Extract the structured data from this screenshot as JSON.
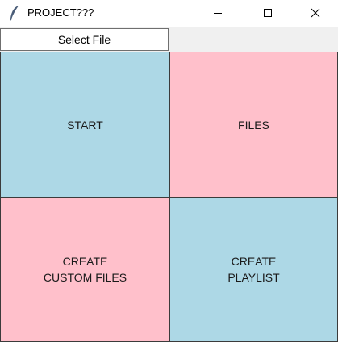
{
  "window": {
    "title": "PROJECT???",
    "app_icon": "feather-icon",
    "controls": [
      "minimize-icon",
      "maximize-icon",
      "close-icon"
    ]
  },
  "toolbar": {
    "select_file_label": "Select File"
  },
  "tiles": [
    {
      "label": "START",
      "color": "#add8e6"
    },
    {
      "label": "FILES",
      "color": "#ffc0cb"
    },
    {
      "label": "CREATE\nCUSTOM FILES",
      "color": "#ffc0cb"
    },
    {
      "label": "CREATE\nPLAYLIST",
      "color": "#add8e6"
    }
  ]
}
